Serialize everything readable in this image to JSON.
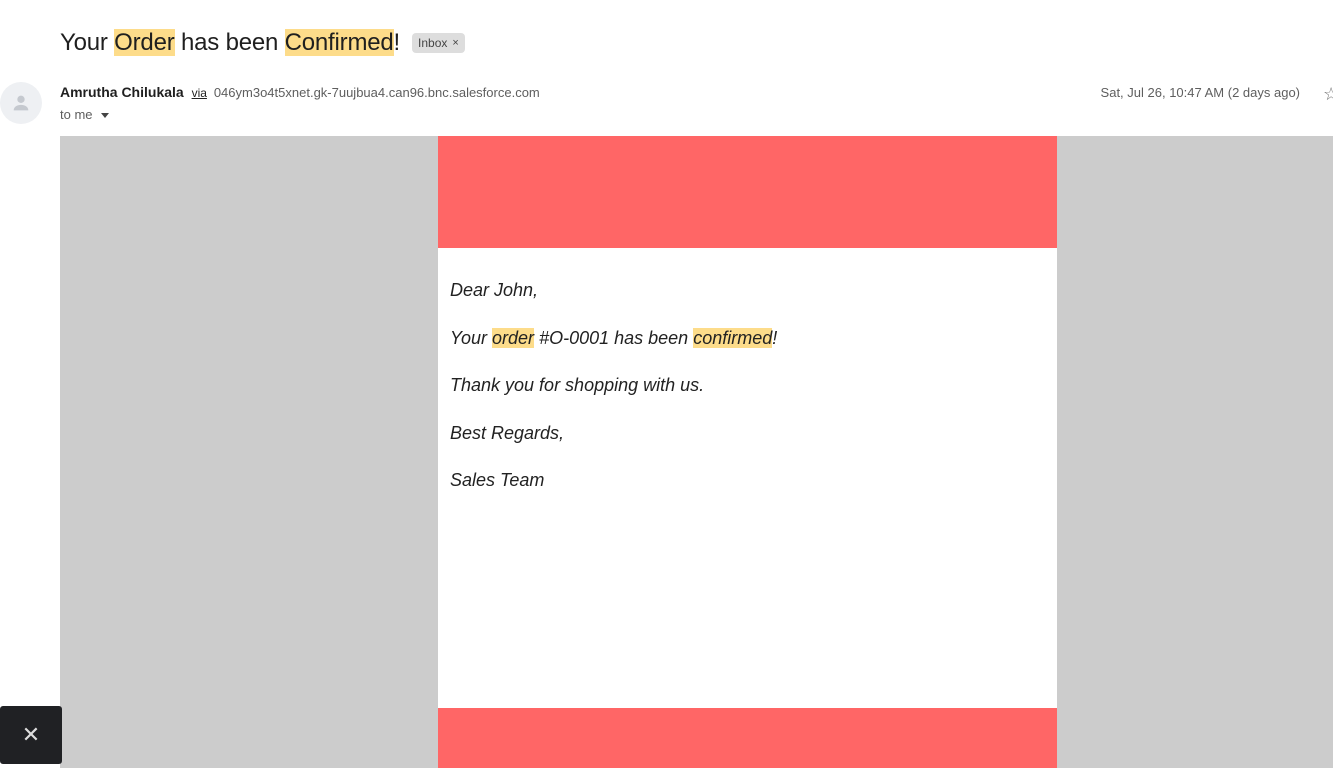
{
  "subject": {
    "part1": "Your ",
    "hl1": "Order",
    "part2": " has been ",
    "hl2": "Confirmed",
    "part3": "!",
    "label": "Inbox",
    "label_close": "×"
  },
  "sender": {
    "name": "Amrutha Chilukala",
    "via": "via",
    "address": "046ym3o4t5xnet.gk-7uujbua4.can96.bnc.salesforce.com",
    "to": "to me",
    "date": "Sat, Jul 26, 10:47 AM (2 days ago)"
  },
  "body": {
    "greeting": "Dear John,",
    "line1_a": "Your ",
    "line1_hl1": "order",
    "line1_b": " #O-0001 has been ",
    "line1_hl2": "confirmed",
    "line1_c": "!",
    "line2": "Thank you for shopping with us.",
    "line3": "Best Regards,",
    "line4": "Sales Team"
  },
  "toast": {
    "close": "✕"
  },
  "colors": {
    "banner": "#ff6666",
    "frame": "#cccccc",
    "highlight": "#fddc8a"
  },
  "icons": {
    "avatar": "person-icon",
    "star": "star-icon",
    "caret": "caret-down-icon"
  }
}
